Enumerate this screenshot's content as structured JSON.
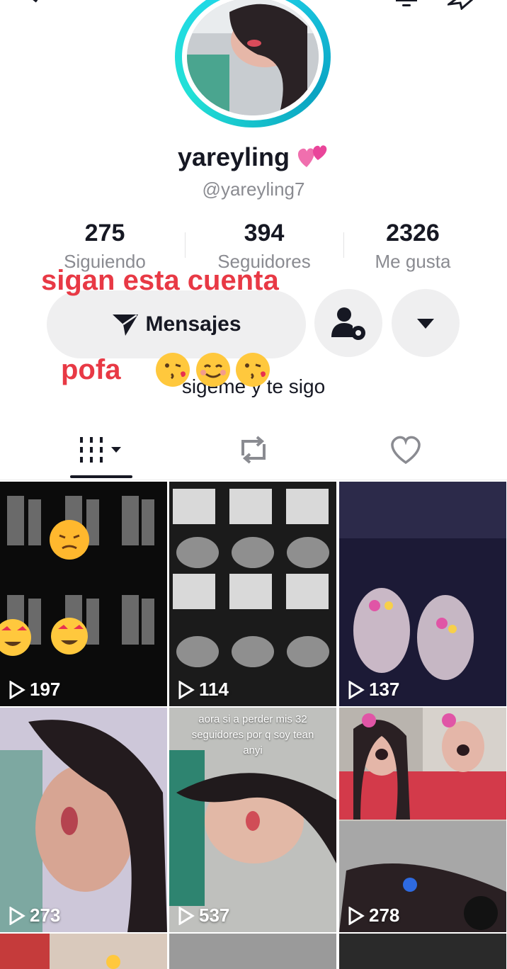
{
  "profile": {
    "display_name": "yareyling",
    "handle": "@yareyling7",
    "bio": "sigeme y te sigo"
  },
  "stats": [
    {
      "value": "275",
      "label": "Siguiendo"
    },
    {
      "value": "394",
      "label": "Seguidores"
    },
    {
      "value": "2326",
      "label": "Me gusta"
    }
  ],
  "overlay": {
    "line1": "sigan esta cuenta",
    "line2": "pofa"
  },
  "buttons": {
    "message_label": "Mensajes"
  },
  "tabs": [
    {
      "icon": "grid-icon"
    },
    {
      "icon": "repost-icon"
    },
    {
      "icon": "heart-icon"
    }
  ],
  "videos": [
    {
      "views": "197"
    },
    {
      "views": "114"
    },
    {
      "views": "137"
    },
    {
      "views": "273"
    },
    {
      "views": "537",
      "caption": "aora si a perder mis 32 seguidores por q soy tean anyi"
    },
    {
      "views": "278"
    }
  ],
  "colors": {
    "ring": "#20d5ec",
    "overlay_text": "#e83945",
    "button_bg": "#efeff0"
  }
}
